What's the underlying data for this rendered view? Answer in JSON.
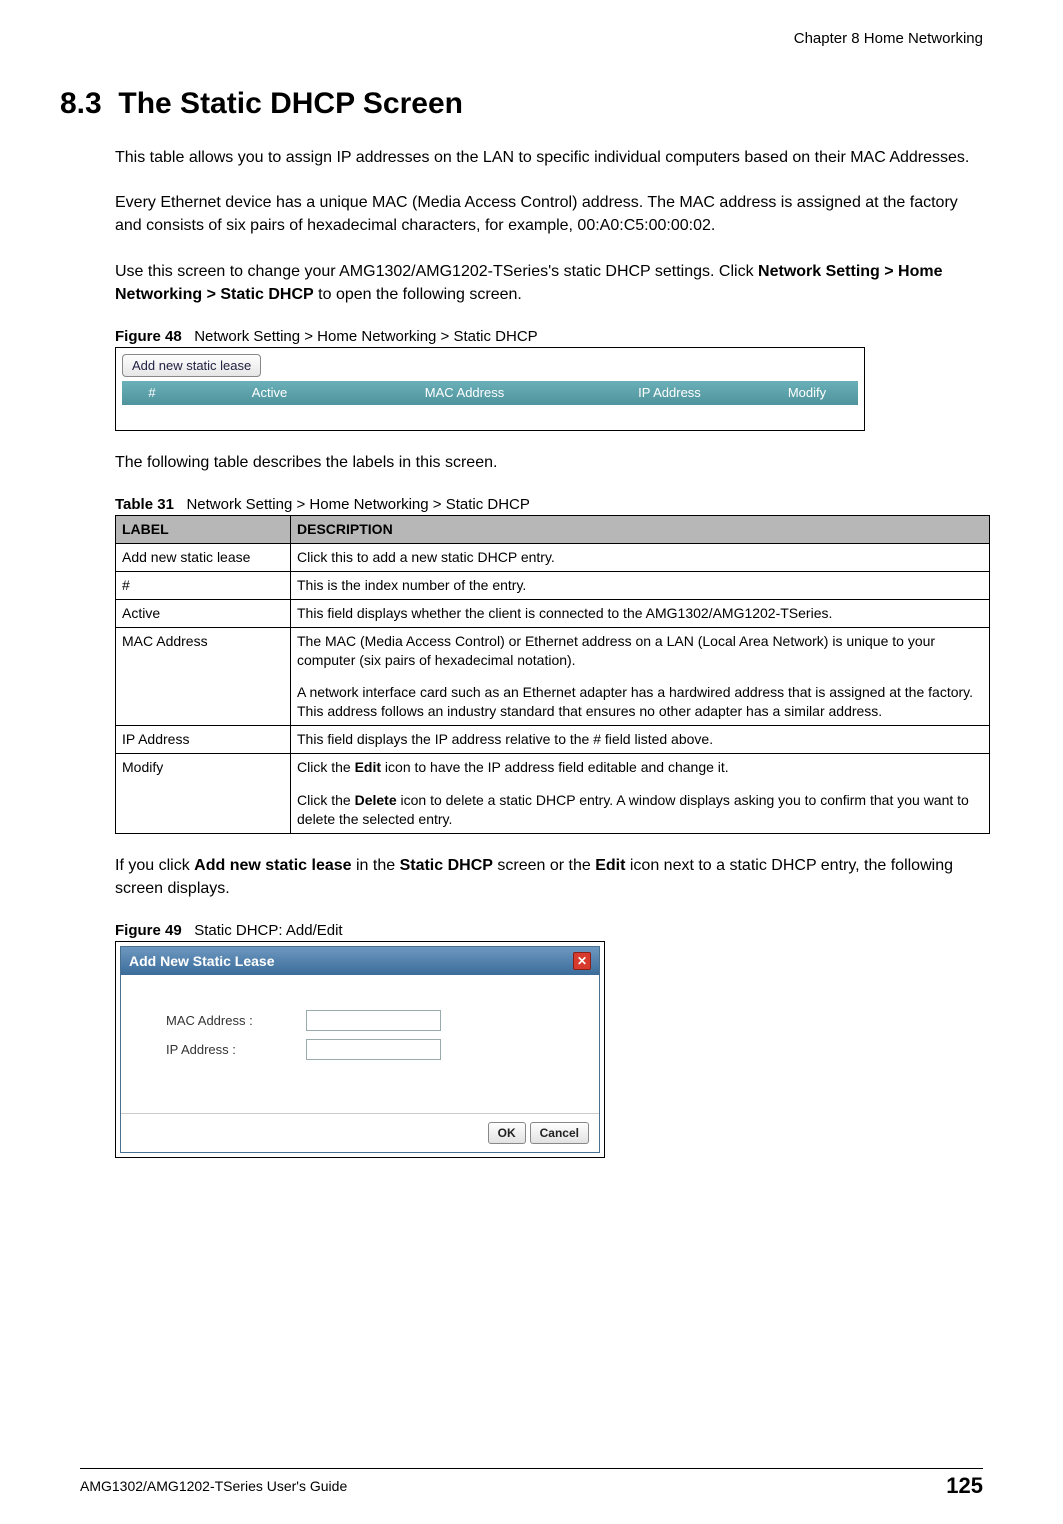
{
  "header": {
    "chapter": "Chapter 8 Home Networking"
  },
  "section": {
    "number": "8.3",
    "title": "The Static DHCP Screen"
  },
  "para1": "This table allows you to assign IP addresses on the LAN to specific individual computers based on their MAC Addresses.",
  "para2": "Every Ethernet device has a unique MAC (Media Access Control) address. The MAC address is assigned at the factory and consists of six pairs of hexadecimal characters, for example, 00:A0:C5:00:00:02.",
  "para3_pre": "Use this screen to change your AMG1302/AMG1202-TSeries's static DHCP settings. Click ",
  "para3_bold": "Network Setting > Home Networking > Static DHCP",
  "para3_post": " to open the following screen.",
  "figure48": {
    "label": "Figure 48",
    "caption": "Network Setting > Home Networking > Static DHCP",
    "button": "Add new static lease",
    "cols": {
      "num": "#",
      "active": "Active",
      "mac": "MAC Address",
      "ip": "IP Address",
      "modify": "Modify"
    }
  },
  "para4": "The following table describes the labels in this screen.",
  "table31": {
    "label": "Table 31",
    "caption": "Network Setting > Home Networking > Static DHCP",
    "headers": {
      "label": "LABEL",
      "description": "DESCRIPTION"
    },
    "rows": [
      {
        "label": "Add new static lease",
        "desc": [
          "Click this to add a new static DHCP entry."
        ]
      },
      {
        "label": "#",
        "desc": [
          "This is the index number of the entry."
        ]
      },
      {
        "label": "Active",
        "desc": [
          "This field displays whether the client is connected to the AMG1302/AMG1202-TSeries."
        ]
      },
      {
        "label": "MAC Address",
        "desc": [
          "The MAC (Media Access Control) or Ethernet address on a LAN (Local Area Network) is unique to your computer (six pairs of hexadecimal notation).",
          "A network interface card such as an Ethernet adapter has a hardwired address that is assigned at the factory. This address follows an industry standard that ensures no other adapter has a similar address."
        ]
      },
      {
        "label": "IP Address",
        "desc": [
          "This field displays the IP address relative to the # field listed above."
        ]
      },
      {
        "label": "Modify",
        "desc_html": true,
        "desc": [
          "Click the <b>Edit</b> icon to have the IP address field editable and change it.",
          "Click the <b>Delete</b> icon to delete a static DHCP entry. A window displays asking you to confirm that you want to delete the selected entry."
        ]
      }
    ]
  },
  "para5_pre": "If you click ",
  "para5_b1": "Add new static lease",
  "para5_mid1": " in the ",
  "para5_b2": "Static DHCP",
  "para5_mid2": " screen or the ",
  "para5_b3": "Edit",
  "para5_post": " icon next to a static DHCP entry, the following screen displays.",
  "figure49": {
    "label": "Figure 49",
    "caption": "Static DHCP: Add/Edit",
    "title": "Add New Static Lease",
    "close": "✕",
    "mac_label": "MAC Address :",
    "ip_label": "IP Address :",
    "ok": "OK",
    "cancel": "Cancel"
  },
  "footer": {
    "guide": "AMG1302/AMG1202-TSeries User's Guide",
    "page": "125"
  }
}
